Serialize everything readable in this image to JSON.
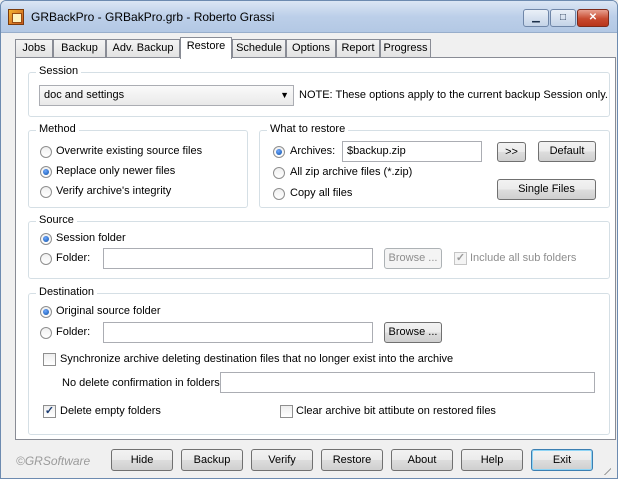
{
  "window": {
    "title": "GRBackPro - GRBakPro.grb - Roberto Grassi",
    "minimize_glyph": "▁",
    "maximize_glyph": "□",
    "close_glyph": "✕"
  },
  "tabs": [
    {
      "label": "Jobs",
      "active": false
    },
    {
      "label": "Backup",
      "active": false
    },
    {
      "label": "Adv. Backup",
      "active": false
    },
    {
      "label": "Restore",
      "active": true
    },
    {
      "label": "Schedule",
      "active": false
    },
    {
      "label": "Options",
      "active": false
    },
    {
      "label": "Report",
      "active": false
    },
    {
      "label": "Progress",
      "active": false
    }
  ],
  "session": {
    "group_label": "Session",
    "selected": "doc and settings",
    "note": "NOTE: These options apply to the current backup Session only."
  },
  "method": {
    "group_label": "Method",
    "options": [
      {
        "label": "Overwrite existing source files",
        "checked": false
      },
      {
        "label": "Replace only newer files",
        "checked": true
      },
      {
        "label": "Verify archive's integrity",
        "checked": false
      }
    ]
  },
  "what_to_restore": {
    "group_label": "What to restore",
    "archives_label": "Archives:",
    "archives_value": "$backup.zip",
    "all_zip_label": "All zip archive files (*.zip)",
    "copy_all_label": "Copy all files",
    "selected": "archives",
    "more_button": ">>",
    "default_button": "Default",
    "single_files_button": "Single Files"
  },
  "source": {
    "group_label": "Source",
    "session_folder_label": "Session folder",
    "folder_label": "Folder:",
    "folder_value": "",
    "selected": "session_folder",
    "browse_button": "Browse ...",
    "include_subfolders_label": "Include all sub folders",
    "include_subfolders_checked": true
  },
  "destination": {
    "group_label": "Destination",
    "original_label": "Original source folder",
    "folder_label": "Folder:",
    "folder_value": "",
    "selected": "original",
    "browse_button": "Browse ...",
    "sync_label": "Synchronize archive deleting destination files that no longer exist into the archive",
    "sync_checked": false,
    "no_delete_label": "No delete confirmation in folders:",
    "no_delete_value": "",
    "delete_empty_label": "Delete empty folders",
    "delete_empty_checked": true,
    "clear_bit_label": "Clear archive bit attibute on restored files",
    "clear_bit_checked": false
  },
  "footer": {
    "brand": "©GRSoftware",
    "buttons": {
      "hide": "Hide",
      "backup": "Backup",
      "verify": "Verify",
      "restore": "Restore",
      "about": "About",
      "help": "Help",
      "exit": "Exit"
    }
  },
  "icons": {
    "app": "app-icon",
    "dropdown": "chevron-down-icon",
    "resize": "resize-grip-icon"
  },
  "colors": {
    "titlebar": "#bccfe9",
    "panel": "#ffffff",
    "window_bg": "#f0f0f0",
    "close_button": "#c74a2f"
  }
}
